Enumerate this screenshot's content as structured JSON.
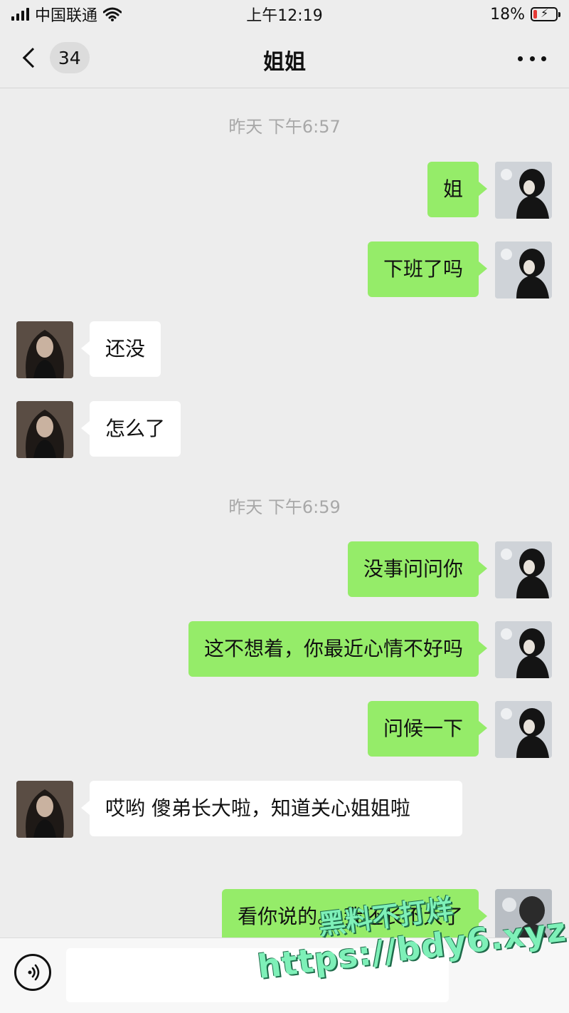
{
  "status_bar": {
    "carrier": "中国联通",
    "time": "上午12:19",
    "battery_percent": "18%",
    "battery_level": 0.18,
    "battery_color": "#e53935"
  },
  "header": {
    "back_icon": "chevron-left-icon",
    "unread_count": "34",
    "title": "姐姐",
    "more_icon": "ellipsis-icon"
  },
  "colors": {
    "background": "#ededed",
    "outgoing_bubble": "#95ec69",
    "incoming_bubble": "#ffffff"
  },
  "chat": {
    "timestamps": [
      "昨天 下午6:57",
      "昨天 下午6:59"
    ],
    "messages": [
      {
        "sender": "me",
        "text": "姐"
      },
      {
        "sender": "me",
        "text": "下班了吗"
      },
      {
        "sender": "her",
        "text": "还没"
      },
      {
        "sender": "her",
        "text": "怎么了"
      },
      {
        "sender": "me",
        "text": "没事问问你"
      },
      {
        "sender": "me",
        "text": "这不想着，你最近心情不好吗"
      },
      {
        "sender": "me",
        "text": "问候一下"
      },
      {
        "sender": "her",
        "text": "哎哟 傻弟长大啦，知道关心姐姐啦"
      },
      {
        "sender": "me",
        "text": "看你说的。 我还长不大了"
      }
    ]
  },
  "input_bar": {
    "voice_icon": "voice-icon",
    "text_value": ""
  },
  "watermark": {
    "line1": "黑料不打烊",
    "line2": "https://bdy6.xyz"
  }
}
